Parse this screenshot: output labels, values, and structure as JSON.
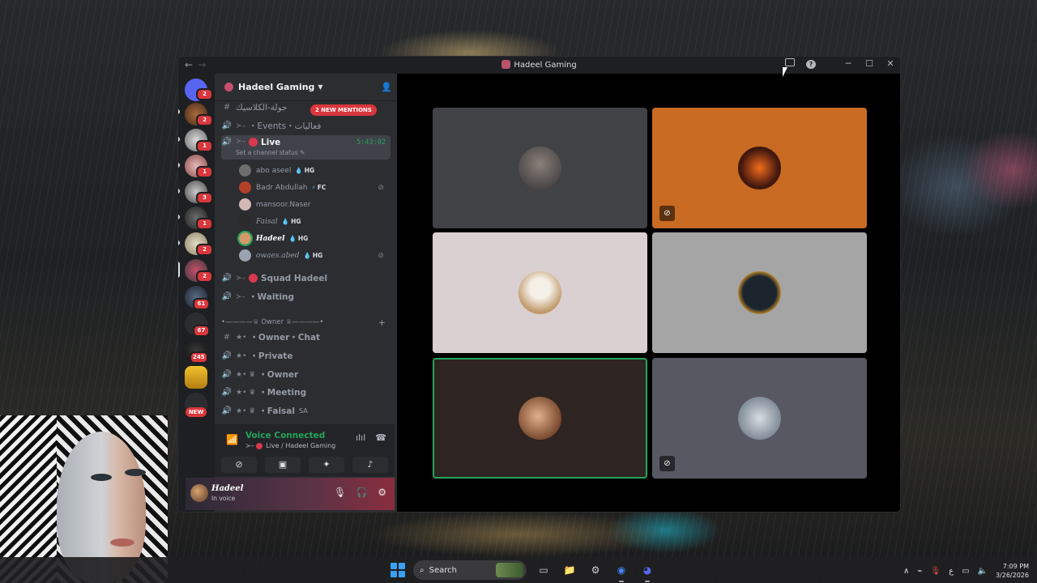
{
  "window": {
    "title": "Hadeel Gaming"
  },
  "server": {
    "name": "Hadeel Gaming"
  },
  "rail_badges": [
    "2",
    "2",
    "1",
    "1",
    "3",
    "1",
    "2",
    "2",
    "61",
    "67",
    "245"
  ],
  "rail_new": "NEW",
  "mentions_pill": "2 NEW MENTIONS",
  "channels": {
    "classic": "جولة-الكلاسيك",
    "events": "・Events・فعاليات",
    "live": {
      "name": "Live",
      "timer": "5:43:02",
      "status": "Set a channel status"
    },
    "squad": "Squad Hadeel",
    "waiting": "・Waiting",
    "owner_category": "•————♕ Owner ♕————•",
    "owner_chat": "・Owner・Chat",
    "private": "・Private",
    "owner": "・Owner",
    "meeting": "・Meeting",
    "faisal": "・Faisal",
    "faisal_suffix": "SA"
  },
  "members": [
    {
      "name": "abo aseel",
      "tag": "HG",
      "muted": false,
      "color": "#6e6e6e"
    },
    {
      "name": "Badr Abdullah",
      "tag": "FC",
      "muted": true,
      "color": "#b5402a"
    },
    {
      "name": "mansoor.Naser",
      "tag": "",
      "muted": false,
      "color": "#d4b8b8"
    },
    {
      "name": "Faisal",
      "tag": "HG",
      "muted": false,
      "color": "#2a2a2a"
    },
    {
      "name": "Hadeel",
      "tag": "HG",
      "muted": false,
      "color": "#d29a6b"
    },
    {
      "name": "owaes.abed",
      "tag": "HG",
      "muted": true,
      "color": "#9aa4b0"
    }
  ],
  "voice": {
    "title": "Voice Connected",
    "subtitle": "Live / Hadeel Gaming"
  },
  "user": {
    "name": "Hadeel",
    "status": "In voice"
  },
  "tiles": [
    {
      "bg": "#414246",
      "avatar": "#4f4c4c",
      "muted": false,
      "speaking": false
    },
    {
      "bg": "#c96a23",
      "avatar": "#3a1a10",
      "muted": true,
      "speaking": false
    },
    {
      "bg": "#dacfd1",
      "avatar": "#caa88a",
      "muted": false,
      "speaking": false
    },
    {
      "bg": "#a5a5a5",
      "avatar": "#1e2a33",
      "muted": false,
      "speaking": false
    },
    {
      "bg": "#2e2422",
      "avatar": "#b27a52",
      "muted": false,
      "speaking": true
    },
    {
      "bg": "#575862",
      "avatar": "#aeb4bb",
      "muted": true,
      "speaking": false
    }
  ],
  "taskbar": {
    "search": "Search",
    "time": "7:09 PM",
    "date": "3/26/2026",
    "lang": "ع"
  }
}
